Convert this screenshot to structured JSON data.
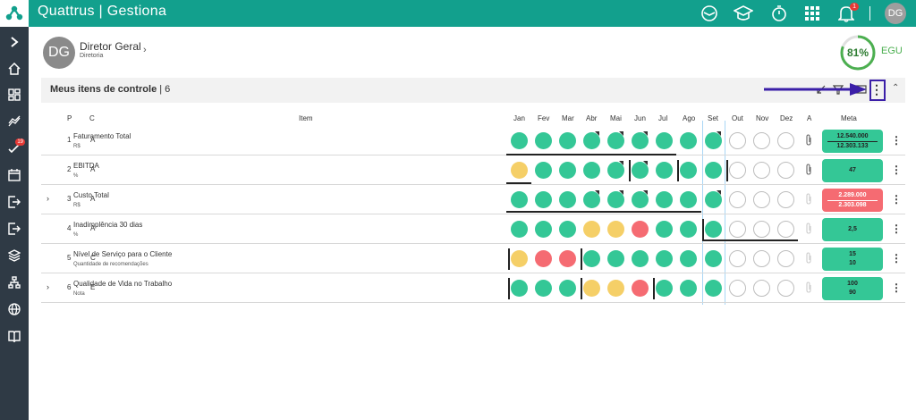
{
  "app": {
    "title": "Quattrus | Gestiona",
    "avatar_initials": "DG",
    "notification_count": "1"
  },
  "topbar_icons": [
    "face-mask-icon",
    "graduation-cap-icon",
    "stopwatch-icon",
    "apps-grid-icon",
    "bell-icon"
  ],
  "sidebar": {
    "items": [
      {
        "icon": "chevron-right-icon"
      },
      {
        "icon": "home-icon"
      },
      {
        "icon": "dashboard-icon"
      },
      {
        "icon": "trend-icon"
      },
      {
        "icon": "check-list-icon",
        "badge": "19"
      },
      {
        "icon": "calendar-icon"
      },
      {
        "icon": "logout-icon"
      },
      {
        "icon": "logout-icon"
      },
      {
        "icon": "layers-icon"
      },
      {
        "icon": "org-chart-icon"
      },
      {
        "icon": "globe-icon"
      },
      {
        "icon": "book-icon"
      }
    ]
  },
  "header": {
    "avatar_initials": "DG",
    "name": "Diretor Geral",
    "role": "Diretoria",
    "egu_value": "81%",
    "egu_label": "EGU",
    "egu_fraction": 0.81
  },
  "panel": {
    "title": "Meus itens de controle",
    "count": "| 6"
  },
  "columns": {
    "p": "P",
    "c": "C",
    "item": "Item",
    "months": [
      "Jan",
      "Fev",
      "Mar",
      "Abr",
      "Mai",
      "Jun",
      "Jul",
      "Ago",
      "Set",
      "Out",
      "Nov",
      "Dez"
    ],
    "a": "A",
    "meta": "Meta"
  },
  "rows": [
    {
      "p": "1",
      "c": "A",
      "name": "Faturamento Total",
      "unit": "R$",
      "dots": [
        "g",
        "g",
        "g",
        "g",
        "g",
        "g",
        "g",
        "g",
        "g",
        "e",
        "e",
        "e"
      ],
      "meta_color": "green",
      "meta_top": "12.540.000",
      "meta_bottom": "12.303.133",
      "expand": false
    },
    {
      "p": "2",
      "c": "A",
      "name": "EBITDA",
      "unit": "%",
      "dots": [
        "y",
        "g",
        "g",
        "g",
        "g",
        "g",
        "g",
        "g",
        "g",
        "e",
        "e",
        "e"
      ],
      "meta_color": "green",
      "meta_top": "",
      "meta_bottom": "47",
      "expand": false
    },
    {
      "p": "3",
      "c": "A",
      "name": "Custo Total",
      "unit": "R$",
      "dots": [
        "g",
        "g",
        "g",
        "g",
        "g",
        "g",
        "g",
        "g",
        "g",
        "e",
        "e",
        "e"
      ],
      "meta_color": "red",
      "meta_top": "2.289.000",
      "meta_bottom": "2.303.098",
      "expand": true
    },
    {
      "p": "4",
      "c": "A",
      "name": "Inadimplência 30 dias",
      "unit": "%",
      "dots": [
        "g",
        "g",
        "g",
        "y",
        "y",
        "r",
        "g",
        "g",
        "g",
        "e",
        "e",
        "e"
      ],
      "meta_color": "green",
      "meta_top": "2,5",
      "meta_bottom": "",
      "expand": false
    },
    {
      "p": "5",
      "c": "C",
      "name": "Nível de Serviço para o Cliente",
      "unit": "Quantidade de recomendações",
      "dots": [
        "y",
        "r",
        "r",
        "g",
        "g",
        "g",
        "g",
        "g",
        "g",
        "e",
        "e",
        "e"
      ],
      "meta_color": "green",
      "meta_top": "15",
      "meta_bottom": "10",
      "expand": false
    },
    {
      "p": "6",
      "c": "E",
      "name": "Qualidade de Vida no Trabalho",
      "unit": "Nota",
      "dots": [
        "g",
        "g",
        "g",
        "y",
        "y",
        "r",
        "g",
        "g",
        "g",
        "e",
        "e",
        "e"
      ],
      "meta_color": "green",
      "meta_top": "100",
      "meta_bottom": "90",
      "expand": true
    }
  ]
}
